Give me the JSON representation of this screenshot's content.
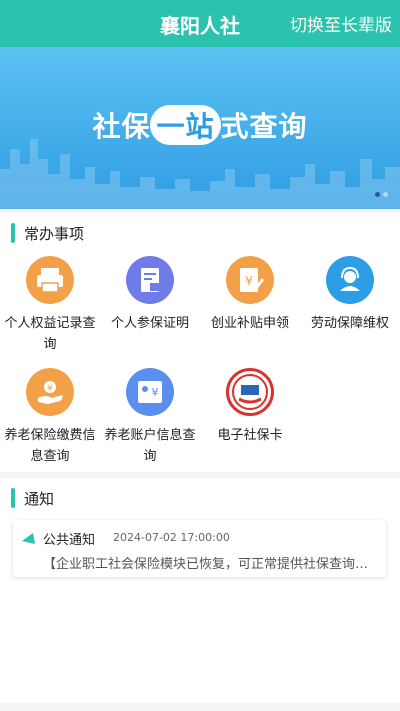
{
  "header": {
    "title": "襄阳人社",
    "switch_label": "切换至长辈版"
  },
  "banner": {
    "text_prefix": "社保",
    "text_pill": "一站",
    "text_mid": "式",
    "text_suffix": "查询",
    "slide_count": 2,
    "active_slide": 1
  },
  "common": {
    "heading": "常办事项",
    "items": [
      {
        "label": "个人权益记录查询",
        "icon": "printer-icon",
        "color": "#f3a148"
      },
      {
        "label": "个人参保证明",
        "icon": "document-icon",
        "color": "#6f7ce8"
      },
      {
        "label": "创业补贴申领",
        "icon": "yuan-document-icon",
        "color": "#f3a148"
      },
      {
        "label": "劳动保障维权",
        "icon": "support-agent-icon",
        "color": "#2c9ee6"
      },
      {
        "label": "养老保险缴费信息查询",
        "icon": "hand-yuan-icon",
        "color": "#f3a148"
      },
      {
        "label": "养老账户信息查询",
        "icon": "account-yuan-icon",
        "color": "#5a8fee"
      },
      {
        "label": "电子社保卡",
        "icon": "social-security-logo-icon",
        "color": "#d9332f"
      }
    ]
  },
  "notices": {
    "heading": "通知",
    "items": [
      {
        "title": "公共通知",
        "time": "2024-07-02 17:00:00",
        "text": "【企业职工社会保险模块已恢复，可正常提供社保查询等服务"
      }
    ]
  },
  "colors": {
    "accent": "#2bc3ad",
    "banner": "#3ea9e8"
  }
}
